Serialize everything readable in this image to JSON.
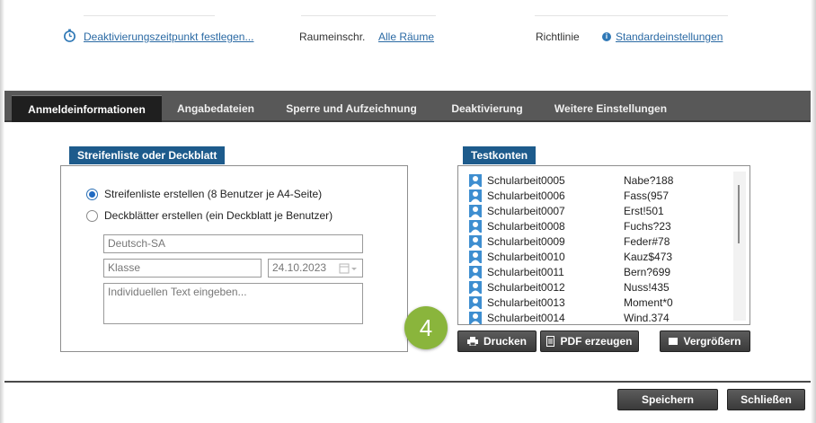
{
  "top_bar": {
    "deactivation_link": "Deaktivierungszeitpunkt festlegen...",
    "room_label": "Raumeinschr.",
    "room_link": "Alle Räume",
    "policy_label": "Richtlinie",
    "policy_link": "Standardeinstellungen"
  },
  "tabs": [
    {
      "label": "Anmeldeinformationen",
      "active": true
    },
    {
      "label": "Angabedateien",
      "active": false
    },
    {
      "label": "Sperre und Aufzeichnung",
      "active": false
    },
    {
      "label": "Deaktivierung",
      "active": false
    },
    {
      "label": "Weitere Einstellungen",
      "active": false
    }
  ],
  "strip_section": {
    "header": "Streifenliste oder Deckblatt",
    "option_list": "Streifenliste erstellen (8 Benutzer je A4-Seite)",
    "option_cover": "Deckblätter erstellen (ein Deckblatt je Benutzer)",
    "selected": "list",
    "subject_value": "Deutsch-SA",
    "class_placeholder": "Klasse",
    "date_value": "24.10.2023",
    "text_placeholder": "Individuellen Text eingeben..."
  },
  "test_accounts": {
    "header": "Testkonten",
    "rows": [
      {
        "user": "Schularbeit0005",
        "password": "Nabe?188"
      },
      {
        "user": "Schularbeit0006",
        "password": "Fass(957"
      },
      {
        "user": "Schularbeit0007",
        "password": "Erst!501"
      },
      {
        "user": "Schularbeit0008",
        "password": "Fuchs?23"
      },
      {
        "user": "Schularbeit0009",
        "password": "Feder#78"
      },
      {
        "user": "Schularbeit0010",
        "password": "Kauz$473"
      },
      {
        "user": "Schularbeit0011",
        "password": "Bern?699"
      },
      {
        "user": "Schularbeit0012",
        "password": "Nuss!435"
      },
      {
        "user": "Schularbeit0013",
        "password": "Moment*0"
      },
      {
        "user": "Schularbeit0014",
        "password": "Wind.374"
      }
    ]
  },
  "actions": {
    "print": "Drucken",
    "pdf": "PDF erzeugen",
    "enlarge": "Vergrößern"
  },
  "step_badge": "4",
  "footer": {
    "save": "Speichern",
    "close": "Schließen"
  },
  "colors": {
    "section_header": "#1d5b8c",
    "tab_bar": "#585858",
    "tab_active": "#1f1f1f",
    "link": "#2b6aa4",
    "badge": "#8ab53c"
  }
}
